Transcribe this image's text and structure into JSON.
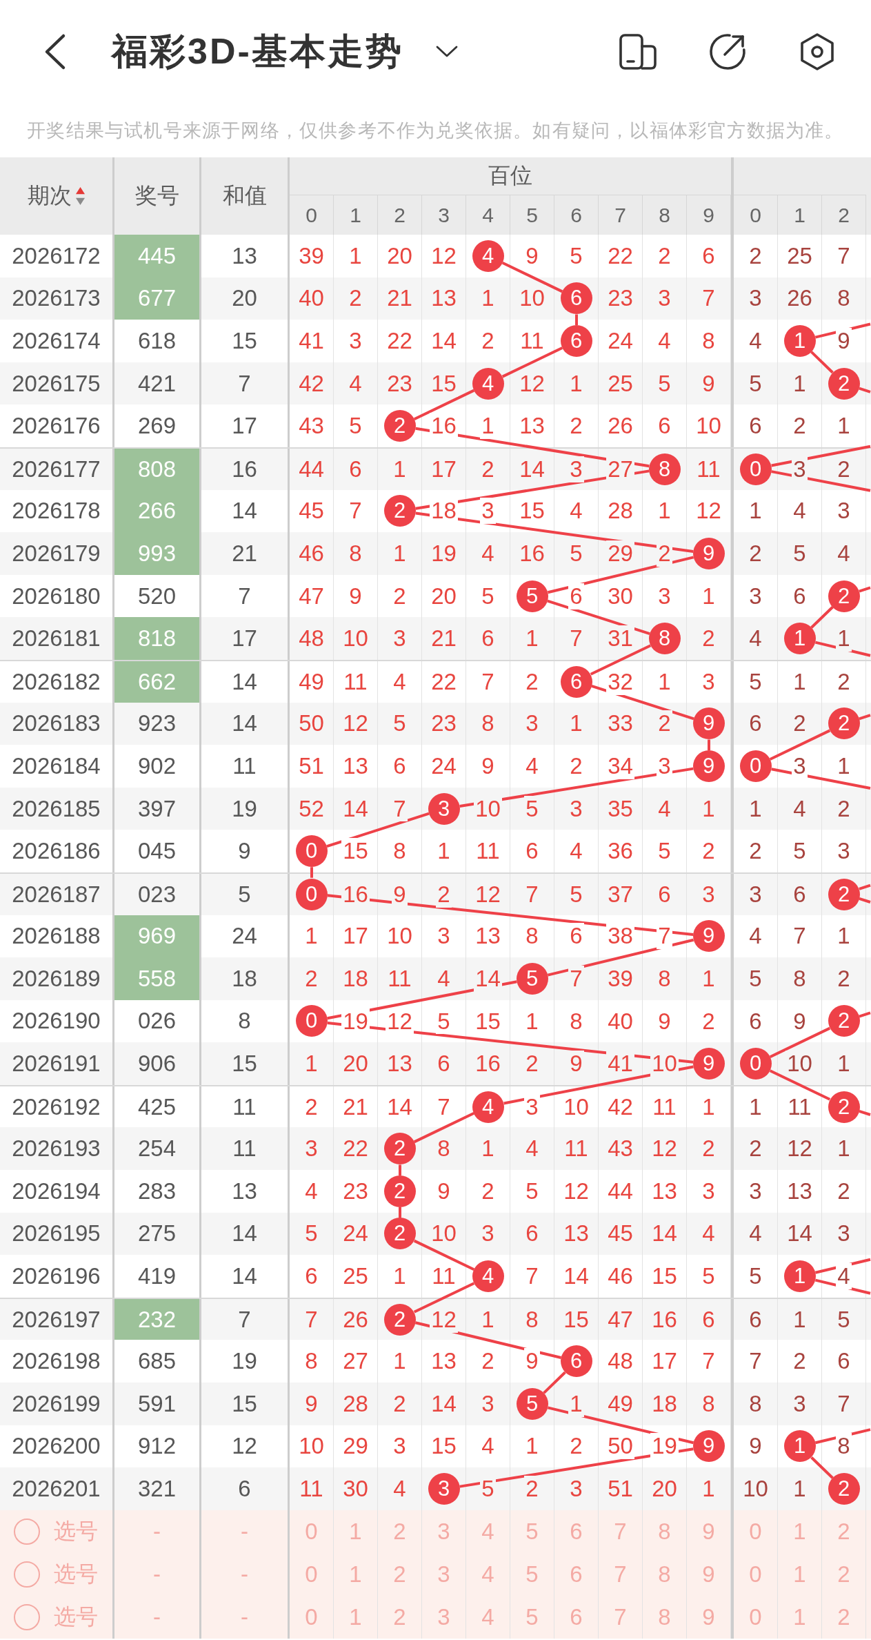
{
  "header": {
    "title": "福彩3D-基本走势"
  },
  "notice": "开奖结果与试机号来源于网络，仅供参考不作为兑奖依据。如有疑问，以福体彩官方数据为准。",
  "table": {
    "columns": [
      {
        "label": "期次",
        "ascending": true
      },
      {
        "label": "奖号"
      },
      {
        "label": "和值"
      }
    ],
    "groups": [
      {
        "label": "百位",
        "digits": [
          "0",
          "1",
          "2",
          "3",
          "4",
          "5",
          "6",
          "7",
          "8",
          "9"
        ]
      },
      {
        "digits": [
          "0",
          "1",
          "2"
        ]
      }
    ],
    "rows": [
      {
        "issue": "2026172",
        "number": "445",
        "highlighted": true,
        "sum": "13",
        "hundreds": [
          {
            "value": "39",
            "hit": false
          },
          {
            "value": "1",
            "hit": false
          },
          {
            "value": "20",
            "hit": false
          },
          {
            "value": "12",
            "hit": false
          },
          {
            "value": "4",
            "hit": true
          },
          {
            "value": "9",
            "hit": false
          },
          {
            "value": "5",
            "hit": false
          },
          {
            "value": "22",
            "hit": false
          },
          {
            "value": "2",
            "hit": false
          },
          {
            "value": "6",
            "hit": false
          }
        ],
        "tens": [
          {
            "value": "2",
            "hit": false
          },
          {
            "value": "25",
            "hit": false
          },
          {
            "value": "7",
            "hit": false
          }
        ]
      },
      {
        "issue": "2026173",
        "number": "677",
        "highlighted": true,
        "sum": "20",
        "hundreds": [
          {
            "value": "40",
            "hit": false
          },
          {
            "value": "2",
            "hit": false
          },
          {
            "value": "21",
            "hit": false
          },
          {
            "value": "13",
            "hit": false
          },
          {
            "value": "1",
            "hit": false
          },
          {
            "value": "10",
            "hit": false
          },
          {
            "value": "6",
            "hit": true
          },
          {
            "value": "23",
            "hit": false
          },
          {
            "value": "3",
            "hit": false
          },
          {
            "value": "7",
            "hit": false
          }
        ],
        "tens": [
          {
            "value": "3",
            "hit": false
          },
          {
            "value": "26",
            "hit": false
          },
          {
            "value": "8",
            "hit": false
          }
        ]
      },
      {
        "issue": "2026174",
        "number": "618",
        "highlighted": false,
        "sum": "15",
        "hundreds": [
          {
            "value": "41",
            "hit": false
          },
          {
            "value": "3",
            "hit": false
          },
          {
            "value": "22",
            "hit": false
          },
          {
            "value": "14",
            "hit": false
          },
          {
            "value": "2",
            "hit": false
          },
          {
            "value": "11",
            "hit": false
          },
          {
            "value": "6",
            "hit": true
          },
          {
            "value": "24",
            "hit": false
          },
          {
            "value": "4",
            "hit": false
          },
          {
            "value": "8",
            "hit": false
          }
        ],
        "tens": [
          {
            "value": "4",
            "hit": false
          },
          {
            "value": "1",
            "hit": true
          },
          {
            "value": "9",
            "hit": false
          }
        ]
      },
      {
        "issue": "2026175",
        "number": "421",
        "highlighted": false,
        "sum": "7",
        "hundreds": [
          {
            "value": "42",
            "hit": false
          },
          {
            "value": "4",
            "hit": false
          },
          {
            "value": "23",
            "hit": false
          },
          {
            "value": "15",
            "hit": false
          },
          {
            "value": "4",
            "hit": true
          },
          {
            "value": "12",
            "hit": false
          },
          {
            "value": "1",
            "hit": false
          },
          {
            "value": "25",
            "hit": false
          },
          {
            "value": "5",
            "hit": false
          },
          {
            "value": "9",
            "hit": false
          }
        ],
        "tens": [
          {
            "value": "5",
            "hit": false
          },
          {
            "value": "1",
            "hit": false
          },
          {
            "value": "2",
            "hit": true
          }
        ]
      },
      {
        "issue": "2026176",
        "number": "269",
        "highlighted": false,
        "sum": "17",
        "hundreds": [
          {
            "value": "43",
            "hit": false
          },
          {
            "value": "5",
            "hit": false
          },
          {
            "value": "2",
            "hit": true
          },
          {
            "value": "16",
            "hit": false
          },
          {
            "value": "1",
            "hit": false
          },
          {
            "value": "13",
            "hit": false
          },
          {
            "value": "2",
            "hit": false
          },
          {
            "value": "26",
            "hit": false
          },
          {
            "value": "6",
            "hit": false
          },
          {
            "value": "10",
            "hit": false
          }
        ],
        "tens": [
          {
            "value": "6",
            "hit": false
          },
          {
            "value": "2",
            "hit": false
          },
          {
            "value": "1",
            "hit": false
          }
        ]
      },
      {
        "issue": "2026177",
        "number": "808",
        "highlighted": true,
        "sum": "16",
        "hundreds": [
          {
            "value": "44",
            "hit": false
          },
          {
            "value": "6",
            "hit": false
          },
          {
            "value": "1",
            "hit": false
          },
          {
            "value": "17",
            "hit": false
          },
          {
            "value": "2",
            "hit": false
          },
          {
            "value": "14",
            "hit": false
          },
          {
            "value": "3",
            "hit": false
          },
          {
            "value": "27",
            "hit": false
          },
          {
            "value": "8",
            "hit": true
          },
          {
            "value": "11",
            "hit": false
          }
        ],
        "tens": [
          {
            "value": "0",
            "hit": true
          },
          {
            "value": "3",
            "hit": false
          },
          {
            "value": "2",
            "hit": false
          }
        ]
      },
      {
        "issue": "2026178",
        "number": "266",
        "highlighted": true,
        "sum": "14",
        "hundreds": [
          {
            "value": "45",
            "hit": false
          },
          {
            "value": "7",
            "hit": false
          },
          {
            "value": "2",
            "hit": true
          },
          {
            "value": "18",
            "hit": false
          },
          {
            "value": "3",
            "hit": false
          },
          {
            "value": "15",
            "hit": false
          },
          {
            "value": "4",
            "hit": false
          },
          {
            "value": "28",
            "hit": false
          },
          {
            "value": "1",
            "hit": false
          },
          {
            "value": "12",
            "hit": false
          }
        ],
        "tens": [
          {
            "value": "1",
            "hit": false
          },
          {
            "value": "4",
            "hit": false
          },
          {
            "value": "3",
            "hit": false
          }
        ]
      },
      {
        "issue": "2026179",
        "number": "993",
        "highlighted": true,
        "sum": "21",
        "hundreds": [
          {
            "value": "46",
            "hit": false
          },
          {
            "value": "8",
            "hit": false
          },
          {
            "value": "1",
            "hit": false
          },
          {
            "value": "19",
            "hit": false
          },
          {
            "value": "4",
            "hit": false
          },
          {
            "value": "16",
            "hit": false
          },
          {
            "value": "5",
            "hit": false
          },
          {
            "value": "29",
            "hit": false
          },
          {
            "value": "2",
            "hit": false
          },
          {
            "value": "9",
            "hit": true
          }
        ],
        "tens": [
          {
            "value": "2",
            "hit": false
          },
          {
            "value": "5",
            "hit": false
          },
          {
            "value": "4",
            "hit": false
          }
        ]
      },
      {
        "issue": "2026180",
        "number": "520",
        "highlighted": false,
        "sum": "7",
        "hundreds": [
          {
            "value": "47",
            "hit": false
          },
          {
            "value": "9",
            "hit": false
          },
          {
            "value": "2",
            "hit": false
          },
          {
            "value": "20",
            "hit": false
          },
          {
            "value": "5",
            "hit": false
          },
          {
            "value": "5",
            "hit": true
          },
          {
            "value": "6",
            "hit": false
          },
          {
            "value": "30",
            "hit": false
          },
          {
            "value": "3",
            "hit": false
          },
          {
            "value": "1",
            "hit": false
          }
        ],
        "tens": [
          {
            "value": "3",
            "hit": false
          },
          {
            "value": "6",
            "hit": false
          },
          {
            "value": "2",
            "hit": true
          }
        ]
      },
      {
        "issue": "2026181",
        "number": "818",
        "highlighted": true,
        "sum": "17",
        "hundreds": [
          {
            "value": "48",
            "hit": false
          },
          {
            "value": "10",
            "hit": false
          },
          {
            "value": "3",
            "hit": false
          },
          {
            "value": "21",
            "hit": false
          },
          {
            "value": "6",
            "hit": false
          },
          {
            "value": "1",
            "hit": false
          },
          {
            "value": "7",
            "hit": false
          },
          {
            "value": "31",
            "hit": false
          },
          {
            "value": "8",
            "hit": true
          },
          {
            "value": "2",
            "hit": false
          }
        ],
        "tens": [
          {
            "value": "4",
            "hit": false
          },
          {
            "value": "1",
            "hit": true
          },
          {
            "value": "1",
            "hit": false
          }
        ]
      },
      {
        "issue": "2026182",
        "number": "662",
        "highlighted": true,
        "sum": "14",
        "hundreds": [
          {
            "value": "49",
            "hit": false
          },
          {
            "value": "11",
            "hit": false
          },
          {
            "value": "4",
            "hit": false
          },
          {
            "value": "22",
            "hit": false
          },
          {
            "value": "7",
            "hit": false
          },
          {
            "value": "2",
            "hit": false
          },
          {
            "value": "6",
            "hit": true
          },
          {
            "value": "32",
            "hit": false
          },
          {
            "value": "1",
            "hit": false
          },
          {
            "value": "3",
            "hit": false
          }
        ],
        "tens": [
          {
            "value": "5",
            "hit": false
          },
          {
            "value": "1",
            "hit": false
          },
          {
            "value": "2",
            "hit": false
          }
        ]
      },
      {
        "issue": "2026183",
        "number": "923",
        "highlighted": false,
        "sum": "14",
        "hundreds": [
          {
            "value": "50",
            "hit": false
          },
          {
            "value": "12",
            "hit": false
          },
          {
            "value": "5",
            "hit": false
          },
          {
            "value": "23",
            "hit": false
          },
          {
            "value": "8",
            "hit": false
          },
          {
            "value": "3",
            "hit": false
          },
          {
            "value": "1",
            "hit": false
          },
          {
            "value": "33",
            "hit": false
          },
          {
            "value": "2",
            "hit": false
          },
          {
            "value": "9",
            "hit": true
          }
        ],
        "tens": [
          {
            "value": "6",
            "hit": false
          },
          {
            "value": "2",
            "hit": false
          },
          {
            "value": "2",
            "hit": true
          }
        ]
      },
      {
        "issue": "2026184",
        "number": "902",
        "highlighted": false,
        "sum": "11",
        "hundreds": [
          {
            "value": "51",
            "hit": false
          },
          {
            "value": "13",
            "hit": false
          },
          {
            "value": "6",
            "hit": false
          },
          {
            "value": "24",
            "hit": false
          },
          {
            "value": "9",
            "hit": false
          },
          {
            "value": "4",
            "hit": false
          },
          {
            "value": "2",
            "hit": false
          },
          {
            "value": "34",
            "hit": false
          },
          {
            "value": "3",
            "hit": false
          },
          {
            "value": "9",
            "hit": true
          }
        ],
        "tens": [
          {
            "value": "0",
            "hit": true
          },
          {
            "value": "3",
            "hit": false
          },
          {
            "value": "1",
            "hit": false
          }
        ]
      },
      {
        "issue": "2026185",
        "number": "397",
        "highlighted": false,
        "sum": "19",
        "hundreds": [
          {
            "value": "52",
            "hit": false
          },
          {
            "value": "14",
            "hit": false
          },
          {
            "value": "7",
            "hit": false
          },
          {
            "value": "3",
            "hit": true
          },
          {
            "value": "10",
            "hit": false
          },
          {
            "value": "5",
            "hit": false
          },
          {
            "value": "3",
            "hit": false
          },
          {
            "value": "35",
            "hit": false
          },
          {
            "value": "4",
            "hit": false
          },
          {
            "value": "1",
            "hit": false
          }
        ],
        "tens": [
          {
            "value": "1",
            "hit": false
          },
          {
            "value": "4",
            "hit": false
          },
          {
            "value": "2",
            "hit": false
          }
        ]
      },
      {
        "issue": "2026186",
        "number": "045",
        "highlighted": false,
        "sum": "9",
        "hundreds": [
          {
            "value": "0",
            "hit": true
          },
          {
            "value": "15",
            "hit": false
          },
          {
            "value": "8",
            "hit": false
          },
          {
            "value": "1",
            "hit": false
          },
          {
            "value": "11",
            "hit": false
          },
          {
            "value": "6",
            "hit": false
          },
          {
            "value": "4",
            "hit": false
          },
          {
            "value": "36",
            "hit": false
          },
          {
            "value": "5",
            "hit": false
          },
          {
            "value": "2",
            "hit": false
          }
        ],
        "tens": [
          {
            "value": "2",
            "hit": false
          },
          {
            "value": "5",
            "hit": false
          },
          {
            "value": "3",
            "hit": false
          }
        ]
      },
      {
        "issue": "2026187",
        "number": "023",
        "highlighted": false,
        "sum": "5",
        "hundreds": [
          {
            "value": "0",
            "hit": true
          },
          {
            "value": "16",
            "hit": false
          },
          {
            "value": "9",
            "hit": false
          },
          {
            "value": "2",
            "hit": false
          },
          {
            "value": "12",
            "hit": false
          },
          {
            "value": "7",
            "hit": false
          },
          {
            "value": "5",
            "hit": false
          },
          {
            "value": "37",
            "hit": false
          },
          {
            "value": "6",
            "hit": false
          },
          {
            "value": "3",
            "hit": false
          }
        ],
        "tens": [
          {
            "value": "3",
            "hit": false
          },
          {
            "value": "6",
            "hit": false
          },
          {
            "value": "2",
            "hit": true
          }
        ]
      },
      {
        "issue": "2026188",
        "number": "969",
        "highlighted": true,
        "sum": "24",
        "hundreds": [
          {
            "value": "1",
            "hit": false
          },
          {
            "value": "17",
            "hit": false
          },
          {
            "value": "10",
            "hit": false
          },
          {
            "value": "3",
            "hit": false
          },
          {
            "value": "13",
            "hit": false
          },
          {
            "value": "8",
            "hit": false
          },
          {
            "value": "6",
            "hit": false
          },
          {
            "value": "38",
            "hit": false
          },
          {
            "value": "7",
            "hit": false
          },
          {
            "value": "9",
            "hit": true
          }
        ],
        "tens": [
          {
            "value": "4",
            "hit": false
          },
          {
            "value": "7",
            "hit": false
          },
          {
            "value": "1",
            "hit": false
          }
        ]
      },
      {
        "issue": "2026189",
        "number": "558",
        "highlighted": true,
        "sum": "18",
        "hundreds": [
          {
            "value": "2",
            "hit": false
          },
          {
            "value": "18",
            "hit": false
          },
          {
            "value": "11",
            "hit": false
          },
          {
            "value": "4",
            "hit": false
          },
          {
            "value": "14",
            "hit": false
          },
          {
            "value": "5",
            "hit": true
          },
          {
            "value": "7",
            "hit": false
          },
          {
            "value": "39",
            "hit": false
          },
          {
            "value": "8",
            "hit": false
          },
          {
            "value": "1",
            "hit": false
          }
        ],
        "tens": [
          {
            "value": "5",
            "hit": false
          },
          {
            "value": "8",
            "hit": false
          },
          {
            "value": "2",
            "hit": false
          }
        ]
      },
      {
        "issue": "2026190",
        "number": "026",
        "highlighted": false,
        "sum": "8",
        "hundreds": [
          {
            "value": "0",
            "hit": true
          },
          {
            "value": "19",
            "hit": false
          },
          {
            "value": "12",
            "hit": false
          },
          {
            "value": "5",
            "hit": false
          },
          {
            "value": "15",
            "hit": false
          },
          {
            "value": "1",
            "hit": false
          },
          {
            "value": "8",
            "hit": false
          },
          {
            "value": "40",
            "hit": false
          },
          {
            "value": "9",
            "hit": false
          },
          {
            "value": "2",
            "hit": false
          }
        ],
        "tens": [
          {
            "value": "6",
            "hit": false
          },
          {
            "value": "9",
            "hit": false
          },
          {
            "value": "2",
            "hit": true
          }
        ]
      },
      {
        "issue": "2026191",
        "number": "906",
        "highlighted": false,
        "sum": "15",
        "hundreds": [
          {
            "value": "1",
            "hit": false
          },
          {
            "value": "20",
            "hit": false
          },
          {
            "value": "13",
            "hit": false
          },
          {
            "value": "6",
            "hit": false
          },
          {
            "value": "16",
            "hit": false
          },
          {
            "value": "2",
            "hit": false
          },
          {
            "value": "9",
            "hit": false
          },
          {
            "value": "41",
            "hit": false
          },
          {
            "value": "10",
            "hit": false
          },
          {
            "value": "9",
            "hit": true
          }
        ],
        "tens": [
          {
            "value": "0",
            "hit": true
          },
          {
            "value": "10",
            "hit": false
          },
          {
            "value": "1",
            "hit": false
          }
        ]
      },
      {
        "issue": "2026192",
        "number": "425",
        "highlighted": false,
        "sum": "11",
        "hundreds": [
          {
            "value": "2",
            "hit": false
          },
          {
            "value": "21",
            "hit": false
          },
          {
            "value": "14",
            "hit": false
          },
          {
            "value": "7",
            "hit": false
          },
          {
            "value": "4",
            "hit": true
          },
          {
            "value": "3",
            "hit": false
          },
          {
            "value": "10",
            "hit": false
          },
          {
            "value": "42",
            "hit": false
          },
          {
            "value": "11",
            "hit": false
          },
          {
            "value": "1",
            "hit": false
          }
        ],
        "tens": [
          {
            "value": "1",
            "hit": false
          },
          {
            "value": "11",
            "hit": false
          },
          {
            "value": "2",
            "hit": true
          }
        ]
      },
      {
        "issue": "2026193",
        "number": "254",
        "highlighted": false,
        "sum": "11",
        "hundreds": [
          {
            "value": "3",
            "hit": false
          },
          {
            "value": "22",
            "hit": false
          },
          {
            "value": "2",
            "hit": true
          },
          {
            "value": "8",
            "hit": false
          },
          {
            "value": "1",
            "hit": false
          },
          {
            "value": "4",
            "hit": false
          },
          {
            "value": "11",
            "hit": false
          },
          {
            "value": "43",
            "hit": false
          },
          {
            "value": "12",
            "hit": false
          },
          {
            "value": "2",
            "hit": false
          }
        ],
        "tens": [
          {
            "value": "2",
            "hit": false
          },
          {
            "value": "12",
            "hit": false
          },
          {
            "value": "1",
            "hit": false
          }
        ]
      },
      {
        "issue": "2026194",
        "number": "283",
        "highlighted": false,
        "sum": "13",
        "hundreds": [
          {
            "value": "4",
            "hit": false
          },
          {
            "value": "23",
            "hit": false
          },
          {
            "value": "2",
            "hit": true
          },
          {
            "value": "9",
            "hit": false
          },
          {
            "value": "2",
            "hit": false
          },
          {
            "value": "5",
            "hit": false
          },
          {
            "value": "12",
            "hit": false
          },
          {
            "value": "44",
            "hit": false
          },
          {
            "value": "13",
            "hit": false
          },
          {
            "value": "3",
            "hit": false
          }
        ],
        "tens": [
          {
            "value": "3",
            "hit": false
          },
          {
            "value": "13",
            "hit": false
          },
          {
            "value": "2",
            "hit": false
          }
        ]
      },
      {
        "issue": "2026195",
        "number": "275",
        "highlighted": false,
        "sum": "14",
        "hundreds": [
          {
            "value": "5",
            "hit": false
          },
          {
            "value": "24",
            "hit": false
          },
          {
            "value": "2",
            "hit": true
          },
          {
            "value": "10",
            "hit": false
          },
          {
            "value": "3",
            "hit": false
          },
          {
            "value": "6",
            "hit": false
          },
          {
            "value": "13",
            "hit": false
          },
          {
            "value": "45",
            "hit": false
          },
          {
            "value": "14",
            "hit": false
          },
          {
            "value": "4",
            "hit": false
          }
        ],
        "tens": [
          {
            "value": "4",
            "hit": false
          },
          {
            "value": "14",
            "hit": false
          },
          {
            "value": "3",
            "hit": false
          }
        ]
      },
      {
        "issue": "2026196",
        "number": "419",
        "highlighted": false,
        "sum": "14",
        "hundreds": [
          {
            "value": "6",
            "hit": false
          },
          {
            "value": "25",
            "hit": false
          },
          {
            "value": "1",
            "hit": false
          },
          {
            "value": "11",
            "hit": false
          },
          {
            "value": "4",
            "hit": true
          },
          {
            "value": "7",
            "hit": false
          },
          {
            "value": "14",
            "hit": false
          },
          {
            "value": "46",
            "hit": false
          },
          {
            "value": "15",
            "hit": false
          },
          {
            "value": "5",
            "hit": false
          }
        ],
        "tens": [
          {
            "value": "5",
            "hit": false
          },
          {
            "value": "1",
            "hit": true
          },
          {
            "value": "4",
            "hit": false
          }
        ]
      },
      {
        "issue": "2026197",
        "number": "232",
        "highlighted": true,
        "sum": "7",
        "hundreds": [
          {
            "value": "7",
            "hit": false
          },
          {
            "value": "26",
            "hit": false
          },
          {
            "value": "2",
            "hit": true
          },
          {
            "value": "12",
            "hit": false
          },
          {
            "value": "1",
            "hit": false
          },
          {
            "value": "8",
            "hit": false
          },
          {
            "value": "15",
            "hit": false
          },
          {
            "value": "47",
            "hit": false
          },
          {
            "value": "16",
            "hit": false
          },
          {
            "value": "6",
            "hit": false
          }
        ],
        "tens": [
          {
            "value": "6",
            "hit": false
          },
          {
            "value": "1",
            "hit": false
          },
          {
            "value": "5",
            "hit": false
          }
        ]
      },
      {
        "issue": "2026198",
        "number": "685",
        "highlighted": false,
        "sum": "19",
        "hundreds": [
          {
            "value": "8",
            "hit": false
          },
          {
            "value": "27",
            "hit": false
          },
          {
            "value": "1",
            "hit": false
          },
          {
            "value": "13",
            "hit": false
          },
          {
            "value": "2",
            "hit": false
          },
          {
            "value": "9",
            "hit": false
          },
          {
            "value": "6",
            "hit": true
          },
          {
            "value": "48",
            "hit": false
          },
          {
            "value": "17",
            "hit": false
          },
          {
            "value": "7",
            "hit": false
          }
        ],
        "tens": [
          {
            "value": "7",
            "hit": false
          },
          {
            "value": "2",
            "hit": false
          },
          {
            "value": "6",
            "hit": false
          }
        ]
      },
      {
        "issue": "2026199",
        "number": "591",
        "highlighted": false,
        "sum": "15",
        "hundreds": [
          {
            "value": "9",
            "hit": false
          },
          {
            "value": "28",
            "hit": false
          },
          {
            "value": "2",
            "hit": false
          },
          {
            "value": "14",
            "hit": false
          },
          {
            "value": "3",
            "hit": false
          },
          {
            "value": "5",
            "hit": true
          },
          {
            "value": "1",
            "hit": false
          },
          {
            "value": "49",
            "hit": false
          },
          {
            "value": "18",
            "hit": false
          },
          {
            "value": "8",
            "hit": false
          }
        ],
        "tens": [
          {
            "value": "8",
            "hit": false
          },
          {
            "value": "3",
            "hit": false
          },
          {
            "value": "7",
            "hit": false
          }
        ]
      },
      {
        "issue": "2026200",
        "number": "912",
        "highlighted": false,
        "sum": "12",
        "hundreds": [
          {
            "value": "10",
            "hit": false
          },
          {
            "value": "29",
            "hit": false
          },
          {
            "value": "3",
            "hit": false
          },
          {
            "value": "15",
            "hit": false
          },
          {
            "value": "4",
            "hit": false
          },
          {
            "value": "1",
            "hit": false
          },
          {
            "value": "2",
            "hit": false
          },
          {
            "value": "50",
            "hit": false
          },
          {
            "value": "19",
            "hit": false
          },
          {
            "value": "9",
            "hit": true
          }
        ],
        "tens": [
          {
            "value": "9",
            "hit": false
          },
          {
            "value": "1",
            "hit": true
          },
          {
            "value": "8",
            "hit": false
          }
        ]
      },
      {
        "issue": "2026201",
        "number": "321",
        "highlighted": false,
        "sum": "6",
        "hundreds": [
          {
            "value": "11",
            "hit": false
          },
          {
            "value": "30",
            "hit": false
          },
          {
            "value": "4",
            "hit": false
          },
          {
            "value": "3",
            "hit": true
          },
          {
            "value": "5",
            "hit": false
          },
          {
            "value": "2",
            "hit": false
          },
          {
            "value": "3",
            "hit": false
          },
          {
            "value": "51",
            "hit": false
          },
          {
            "value": "20",
            "hit": false
          },
          {
            "value": "1",
            "hit": false
          }
        ],
        "tens": [
          {
            "value": "10",
            "hit": false
          },
          {
            "value": "1",
            "hit": false
          },
          {
            "value": "2",
            "hit": true
          }
        ]
      }
    ],
    "pick_rows": [
      {
        "label": "选号",
        "selected": false,
        "number": "-",
        "sum": "-",
        "hundreds": [
          "0",
          "1",
          "2",
          "3",
          "4",
          "5",
          "6",
          "7",
          "8",
          "9"
        ],
        "tens": [
          "0",
          "1",
          "2"
        ]
      },
      {
        "label": "选号",
        "selected": false,
        "number": "-",
        "sum": "-",
        "hundreds": [
          "0",
          "1",
          "2",
          "3",
          "4",
          "5",
          "6",
          "7",
          "8",
          "9"
        ],
        "tens": [
          "0",
          "1",
          "2"
        ]
      },
      {
        "label": "选号",
        "selected": false,
        "number": "-",
        "sum": "-",
        "hundreds": [
          "0",
          "1",
          "2",
          "3",
          "4",
          "5",
          "6",
          "7",
          "8",
          "9"
        ],
        "tens": [
          "0",
          "1",
          "2"
        ]
      }
    ]
  }
}
